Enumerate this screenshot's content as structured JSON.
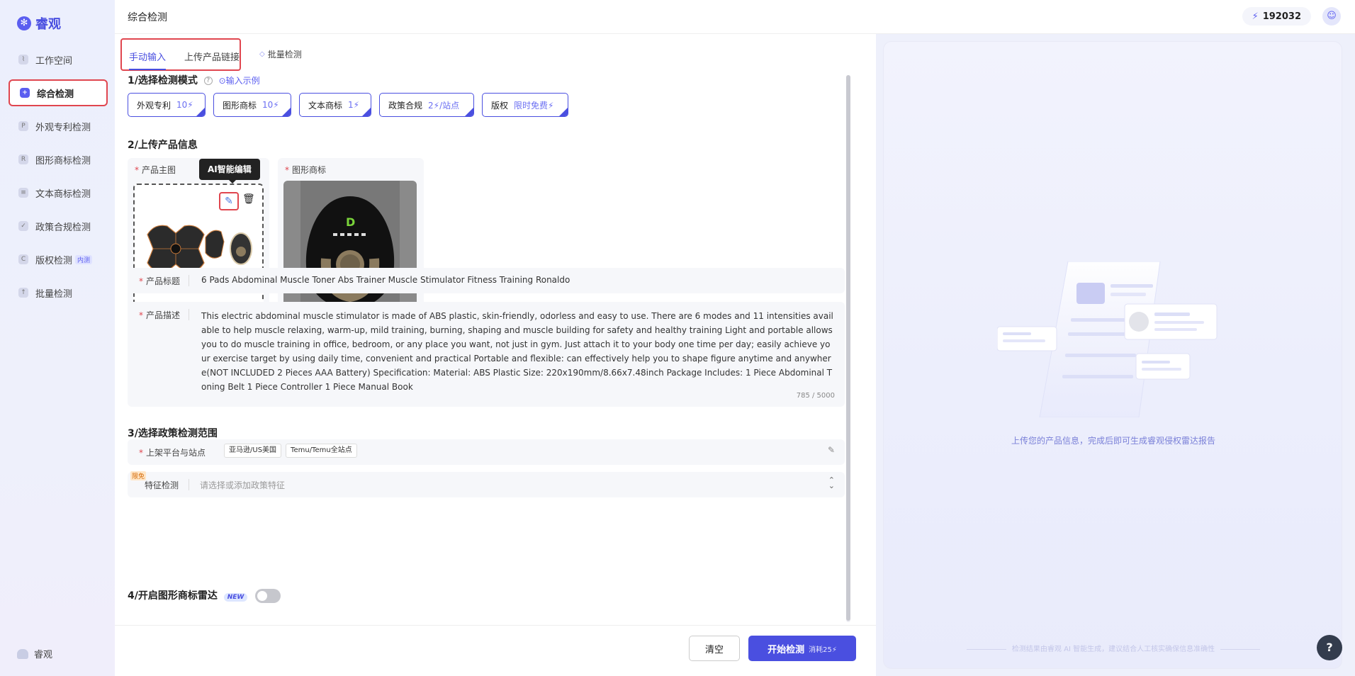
{
  "sidebar": {
    "logo": "睿观",
    "logo_mark": "✻",
    "items": [
      {
        "label": "工作空间",
        "icon": "chart-icon",
        "glyph": "⌇"
      },
      {
        "label": "综合检测",
        "icon": "plus-search-icon",
        "glyph": "+"
      },
      {
        "label": "外观专利检测",
        "icon": "p-icon",
        "glyph": "P"
      },
      {
        "label": "图形商标检测",
        "icon": "r-icon",
        "glyph": "R"
      },
      {
        "label": "文本商标检测",
        "icon": "text-icon",
        "glyph": "≡"
      },
      {
        "label": "政策合规检测",
        "icon": "check-icon",
        "glyph": "✓"
      },
      {
        "label": "版权检测",
        "icon": "copyright-icon",
        "glyph": "C",
        "badge": "内测"
      },
      {
        "label": "批量检测",
        "icon": "upload-icon",
        "glyph": "↑"
      }
    ],
    "user": "睿观"
  },
  "header": {
    "title": "综合检测",
    "credits": "192032",
    "bolt": "⚡",
    "avatar": "☺"
  },
  "tabs": {
    "manual": "手动输入",
    "link": "上传产品链接",
    "batch": "批量检测"
  },
  "section1": {
    "title": "1/选择检测模式",
    "help": "?",
    "example": "⊙输入示例",
    "modes": [
      {
        "label": "外观专利",
        "cost": "10⚡"
      },
      {
        "label": "图形商标",
        "cost": "10⚡"
      },
      {
        "label": "文本商标",
        "cost": "1⚡"
      },
      {
        "label": "政策合规",
        "cost": "2⚡/站点"
      },
      {
        "label": "版权",
        "cost": "限时免费⚡"
      }
    ]
  },
  "section2": {
    "title": "2/上传产品信息",
    "main_image_label": "产品主图",
    "logo_label": "图形商标",
    "tooltip": "AI智能编辑",
    "title_label": "产品标题",
    "title_value": "6 Pads Abdominal Muscle Toner Abs Trainer Muscle Stimulator Fitness Training Ronaldo",
    "desc_label": "产品描述",
    "desc_value": "This electric abdominal muscle stimulator is made of ABS plastic, skin-friendly, odorless and easy to use. There are 6 modes and 11 intensities available to help muscle relaxing, warm-up, mild training, burning, shaping and muscle building for safety and healthy training Light and portable allows you to do muscle training in office, bedroom, or any place you want, not just in gym. Just attach it to your body one time per day; easily achieve your exercise target by using daily time, convenient and practical Portable and flexible: can effectively help you to shape figure anytime and anywhere(NOT INCLUDED 2 Pieces AAA Battery) Specification: Material: ABS Plastic Size: 220x190mm/8.66x7.48inch Package Includes: 1 Piece Abdominal Toning Belt 1 Piece Controller 1 Piece Manual Book",
    "desc_counter": "785 / 5000"
  },
  "section3": {
    "title": "3/选择政策检测范围",
    "platform_label": "上架平台与站点",
    "platform_tags": [
      "亚马逊/US美国",
      "Temu/Temu全站点"
    ],
    "feature_badge": "限免",
    "feature_label": "特征检测",
    "feature_placeholder": "请选择或添加政策特征"
  },
  "section4": {
    "title": "4/开启图形商标雷达",
    "badge": "NEW"
  },
  "footer": {
    "clear": "清空",
    "start": "开始检测",
    "start_cost": "消耗25⚡"
  },
  "right": {
    "hint": "上传您的产品信息，完成后即可生成睿观侵权雷达报告",
    "footer": "检测结果由睿观 AI 智能生成，建议结合人工核实确保信息准确性",
    "help": "?"
  },
  "colors": {
    "accent": "#4a4fe0",
    "highlight": "#e0464f"
  }
}
